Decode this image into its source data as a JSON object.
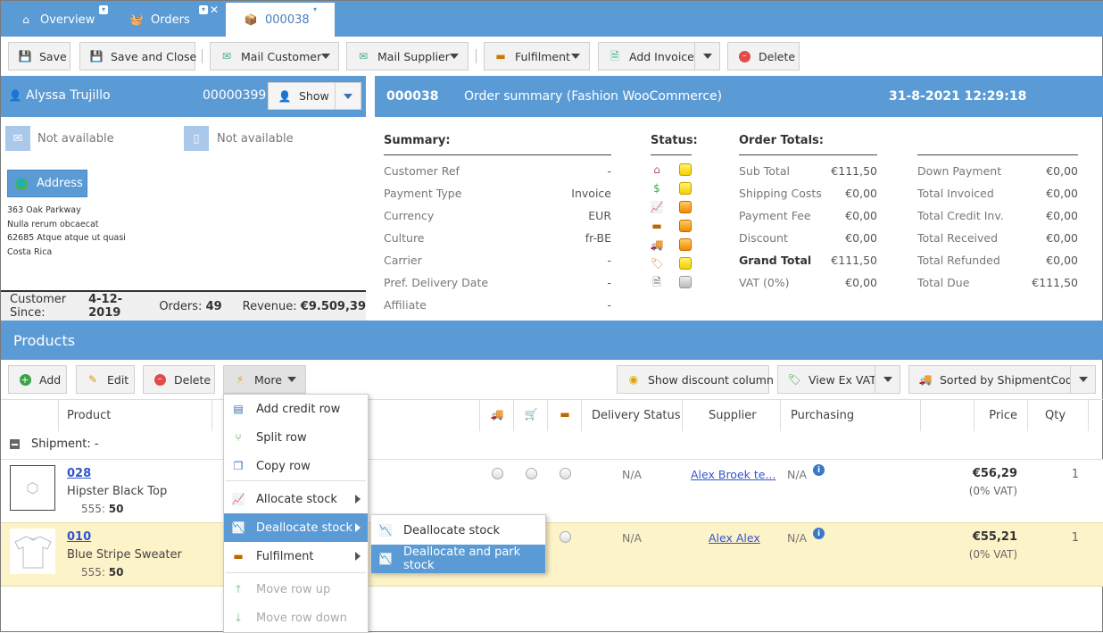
{
  "tabs": [
    {
      "label": "Overview",
      "icon": "home-icon"
    },
    {
      "label": "Orders",
      "icon": "basket-icon"
    },
    {
      "label": "000038",
      "icon": "order-icon",
      "active": true
    }
  ],
  "toolbar": {
    "save": "Save",
    "save_close": "Save and Close",
    "mail_customer": "Mail Customer",
    "mail_supplier": "Mail Supplier",
    "fulfilment": "Fulfilment",
    "add_invoice": "Add Invoice",
    "delete": "Delete"
  },
  "customer": {
    "name": "Alyssa Trujillo",
    "number": "00000399",
    "show": "Show",
    "email": "Not available",
    "phone": "Not available",
    "address_button": "Address",
    "address_lines": [
      "363 Oak Parkway",
      "Nulla rerum obcaecat",
      "62685 Atque atque ut quasi",
      "Costa Rica"
    ],
    "since_label": "Customer Since:",
    "since": "4-12-2019",
    "orders_label": "Orders:",
    "orders": "49",
    "revenue_label": "Revenue:",
    "revenue": "€9.509,39"
  },
  "order": {
    "number": "000038",
    "title": "Order summary (Fashion WooCommerce)",
    "datetime": "31-8-2021 12:29:18"
  },
  "summary": {
    "heading": "Summary:",
    "rows": [
      {
        "label": "Customer Ref",
        "value": "-"
      },
      {
        "label": "Payment Type",
        "value": "Invoice"
      },
      {
        "label": "Currency",
        "value": "EUR"
      },
      {
        "label": "Culture",
        "value": "fr-BE"
      },
      {
        "label": "Carrier",
        "value": "-"
      },
      {
        "label": "Pref. Delivery Date",
        "value": "-"
      },
      {
        "label": "Affiliate",
        "value": "-"
      }
    ]
  },
  "status": {
    "heading": "Status:",
    "rows": [
      {
        "icon": "house-icon",
        "color": "yellow"
      },
      {
        "icon": "money-icon",
        "color": "yellow"
      },
      {
        "icon": "chart-icon",
        "color": "orange"
      },
      {
        "icon": "box-icon",
        "color": "orange"
      },
      {
        "icon": "truck-icon",
        "color": "orange"
      },
      {
        "icon": "tag-icon",
        "color": "yellow"
      },
      {
        "icon": "document-icon",
        "color": "grey"
      }
    ]
  },
  "totals": {
    "heading": "Order Totals:",
    "left": [
      {
        "label": "Sub Total",
        "value": "€111,50"
      },
      {
        "label": "Shipping Costs",
        "value": "€0,00"
      },
      {
        "label": "Payment Fee",
        "value": "€0,00"
      },
      {
        "label": "Discount",
        "value": "€0,00"
      },
      {
        "label": "Grand Total",
        "value": "€111,50",
        "bold": true
      },
      {
        "label": "VAT (0%)",
        "value": "€0,00"
      }
    ],
    "right": [
      {
        "label": "Down Payment",
        "value": "€0,00"
      },
      {
        "label": "Total Invoiced",
        "value": "€0,00"
      },
      {
        "label": "Total Credit Inv.",
        "value": "€0,00"
      },
      {
        "label": "Total Received",
        "value": "€0,00"
      },
      {
        "label": "Total Refunded",
        "value": "€0,00"
      },
      {
        "label": "Total Due",
        "value": "€111,50"
      }
    ]
  },
  "products": {
    "title": "Products",
    "add": "Add",
    "edit": "Edit",
    "delete": "Delete",
    "more": "More",
    "show_discount": "Show discount column",
    "view_ex_vat": "View Ex VAT",
    "sorted": "Sorted by ShipmentCode",
    "columns": {
      "product": "Product",
      "delivery_status": "Delivery Status",
      "supplier": "Supplier",
      "purchasing": "Purchasing",
      "price": "Price",
      "qty": "Qty"
    },
    "shipment": "Shipment: -",
    "rows": [
      {
        "code": "028",
        "name": "Hipster Black Top",
        "sku_label": "555:",
        "sku": "50",
        "delivery": "N/A",
        "supplier": "Alex Broek te...",
        "purchasing": "N/A",
        "price": "€56,29",
        "vat": "(0% VAT)",
        "qty": "1"
      },
      {
        "code": "010",
        "name": "Blue Stripe Sweater",
        "sku_label": "555:",
        "sku": "50",
        "delivery": "N/A",
        "supplier": "Alex Alex",
        "purchasing": "N/A",
        "price": "€55,21",
        "vat": "(0% VAT)",
        "qty": "1"
      }
    ]
  },
  "more_menu": {
    "items": [
      "Add credit row",
      "Split row",
      "Copy row",
      "Allocate stock",
      "Deallocate stock",
      "Fulfilment",
      "Move row up",
      "Move row down"
    ]
  },
  "submenu": {
    "items": [
      "Deallocate stock",
      "Deallocate and park stock"
    ]
  }
}
